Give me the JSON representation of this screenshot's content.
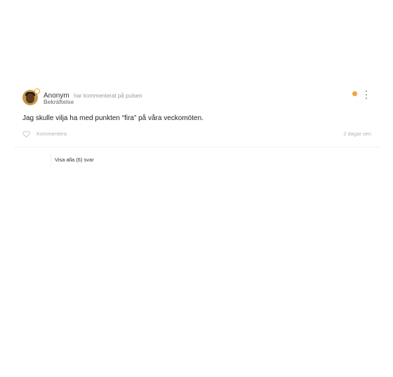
{
  "post": {
    "author": "Anonym",
    "action": "har kommenterat på pulsen",
    "category": "Bekräftelse",
    "status_color": "#f3a33d",
    "message": "Jag skulle vilja ha med punkten “fira” på våra veckomöten.",
    "comment_label": "Kommentera",
    "time_ago": "2 dagar sen",
    "icons": {
      "avatar": "avatar-image",
      "badge": "circle-badge-icon",
      "menu": "kebab-menu-icon",
      "like": "heart-icon"
    }
  },
  "replies": {
    "link_label": "Visa alla (6) svar"
  }
}
